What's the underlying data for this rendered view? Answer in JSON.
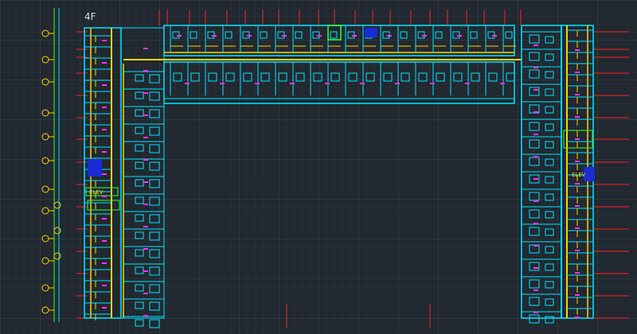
{
  "drawing": {
    "floor_label": "4F",
    "elevator_west_label": "ELEV",
    "elevator_east_label": "ELEV"
  },
  "colors": {
    "background": "#212830",
    "walls": "#00e5ff",
    "corridor": "#ffd400",
    "dimension": "#ff1f5a",
    "gridline": "#ff2020",
    "text": "#ff33ff",
    "elevator": "#1b2bd6",
    "accent_green": "#33ff33"
  },
  "icons": {
    "grid_bubble": "circle-marker",
    "elevator_core": "filled-blue-square"
  }
}
